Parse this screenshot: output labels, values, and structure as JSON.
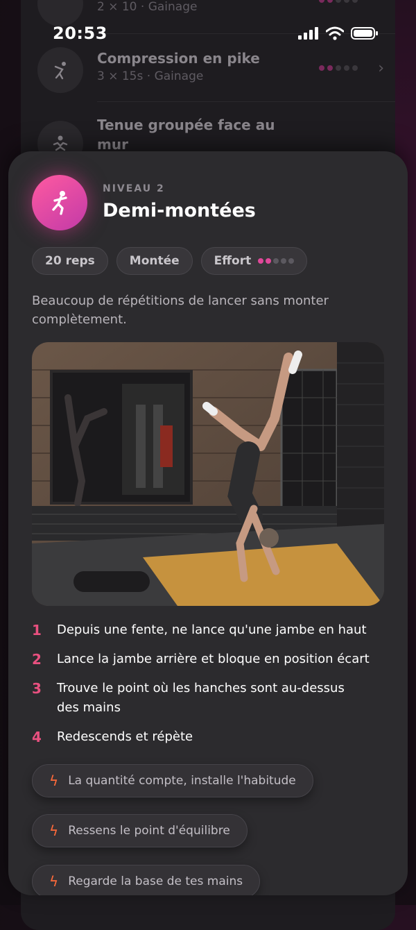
{
  "status_bar": {
    "time": "20:53"
  },
  "background_list": {
    "items": [
      {
        "title": "",
        "subtitle": "2 × 10 · Gainage"
      },
      {
        "title": "Compression en pike",
        "subtitle": "3 × 15s · Gainage"
      },
      {
        "title": "Tenue groupée face au mur",
        "subtitle": ""
      }
    ]
  },
  "exercise": {
    "level": "NIVEAU 2",
    "title": "Demi-montées",
    "chips": {
      "reps": "20 reps",
      "category": "Montée",
      "effort_label": "Effort",
      "effort_level": 2,
      "effort_max": 5
    },
    "description": "Beaucoup de répétitions de lancer sans monter complètement.",
    "steps": [
      {
        "n": "1",
        "text": "Depuis une fente, ne lance qu'une jambe en haut"
      },
      {
        "n": "2",
        "text": "Lance la jambe arrière et bloque en position écart"
      },
      {
        "n": "3",
        "text": "Trouve le point où les hanches sont au-dessus des mains"
      },
      {
        "n": "4",
        "text": "Redescends et répète"
      }
    ],
    "tips": [
      "La quantité compte, installe l'habitude",
      "Ressens le point d'équilibre",
      "Regarde la base de tes mains"
    ]
  },
  "colors": {
    "accent": "#e0489a",
    "step_number": "#e8507f",
    "tip_icon": "#ff6a3a"
  }
}
